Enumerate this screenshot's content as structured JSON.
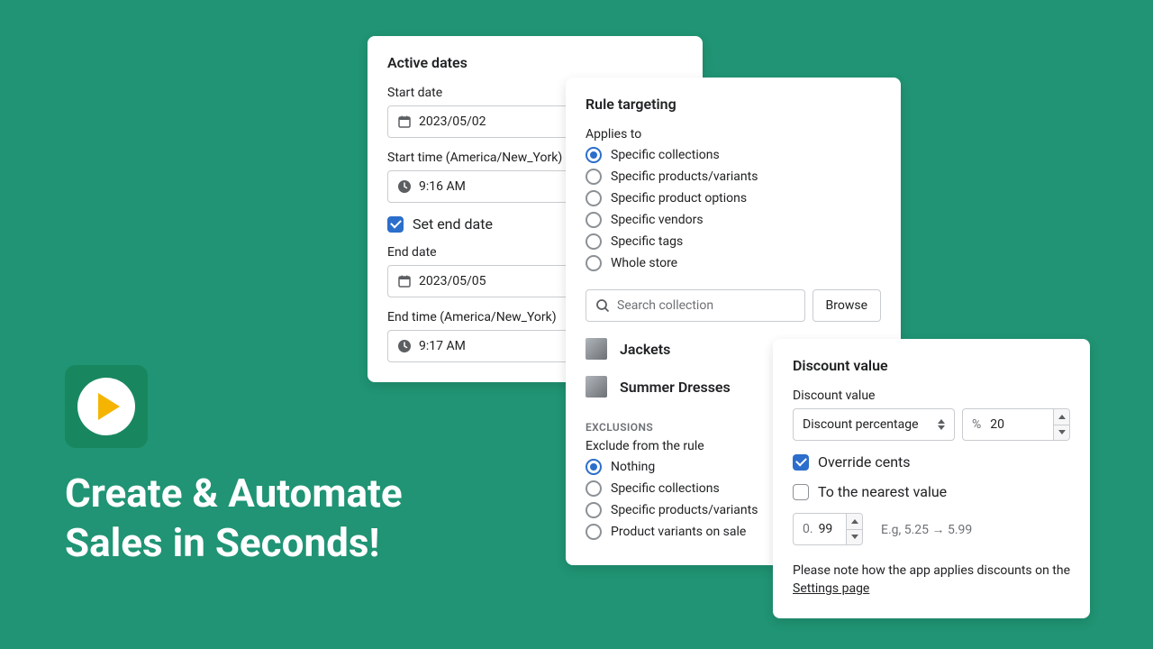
{
  "hero": {
    "headline_l1": "Create & Automate",
    "headline_l2": "Sales in Seconds!"
  },
  "dates": {
    "title": "Active dates",
    "start_date_label": "Start date",
    "start_date": "2023/05/02",
    "start_time_label": "Start time (America/New_York)",
    "start_time": "9:16 AM",
    "set_end_label": "Set end date",
    "set_end_checked": true,
    "end_date_label": "End date",
    "end_date": "2023/05/05",
    "end_time_label": "End time (America/New_York)",
    "end_time": "9:17 AM"
  },
  "targeting": {
    "title": "Rule targeting",
    "applies_label": "Applies to",
    "applies_options": [
      "Specific collections",
      "Specific products/variants",
      "Specific product options",
      "Specific vendors",
      "Specific tags",
      "Whole store"
    ],
    "applies_selected": 0,
    "search_placeholder": "Search collection",
    "browse_label": "Browse",
    "collections": [
      {
        "name": "Jackets"
      },
      {
        "name": "Summer Dresses"
      }
    ],
    "exclusions_title": "EXCLUSIONS",
    "exclude_label": "Exclude from the rule",
    "exclude_options": [
      "Nothing",
      "Specific collections",
      "Specific products/variants",
      "Product variants on sale"
    ],
    "exclude_selected": 0
  },
  "discount": {
    "title": "Discount value",
    "value_label": "Discount value",
    "select_label": "Discount percentage",
    "unit": "%",
    "amount": "20",
    "override_label": "Override cents",
    "override_checked": true,
    "nearest_label": "To the nearest value",
    "nearest_checked": false,
    "cents_prefix": "0.",
    "cents_value": "99",
    "example": "E.g, 5.25 → 5.99",
    "note_prefix": "Please note how the app applies discounts on the ",
    "note_link": "Settings page"
  }
}
